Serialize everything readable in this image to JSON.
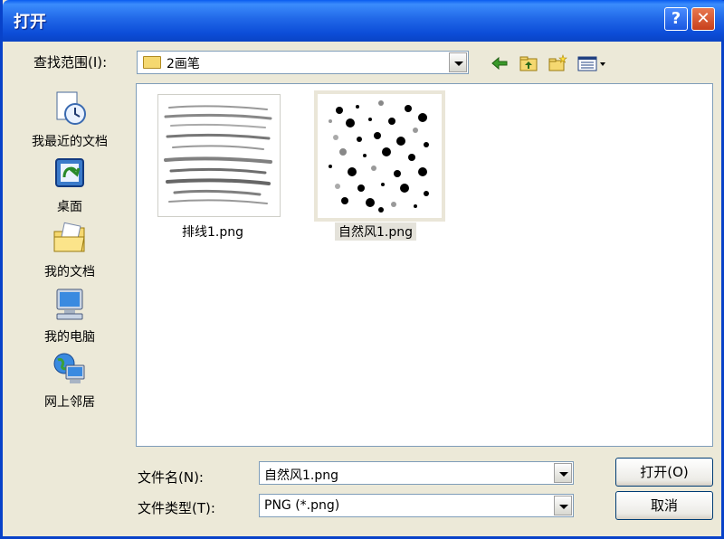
{
  "window": {
    "title": "打开",
    "help_label": "?",
    "close_label": "✕"
  },
  "lookin": {
    "label": "查找范围(I):",
    "value": "2画笔"
  },
  "toolbar": {
    "icons": [
      "back-icon",
      "up-folder-icon",
      "new-folder-icon",
      "view-menu-icon"
    ]
  },
  "places": [
    {
      "label": "我最近的文档",
      "icon": "recent-documents-icon"
    },
    {
      "label": "桌面",
      "icon": "desktop-icon"
    },
    {
      "label": "我的文档",
      "icon": "my-documents-icon"
    },
    {
      "label": "我的电脑",
      "icon": "my-computer-icon"
    },
    {
      "label": "网上邻居",
      "icon": "network-places-icon"
    }
  ],
  "files": [
    {
      "name": "排线1.png",
      "selected": false
    },
    {
      "name": "自然风1.png",
      "selected": true
    }
  ],
  "filename": {
    "label": "文件名(N):",
    "value": "自然风1.png"
  },
  "filetype": {
    "label": "文件类型(T):",
    "value": "PNG (*.png)"
  },
  "buttons": {
    "open": "打开(O)",
    "cancel": "取消"
  }
}
